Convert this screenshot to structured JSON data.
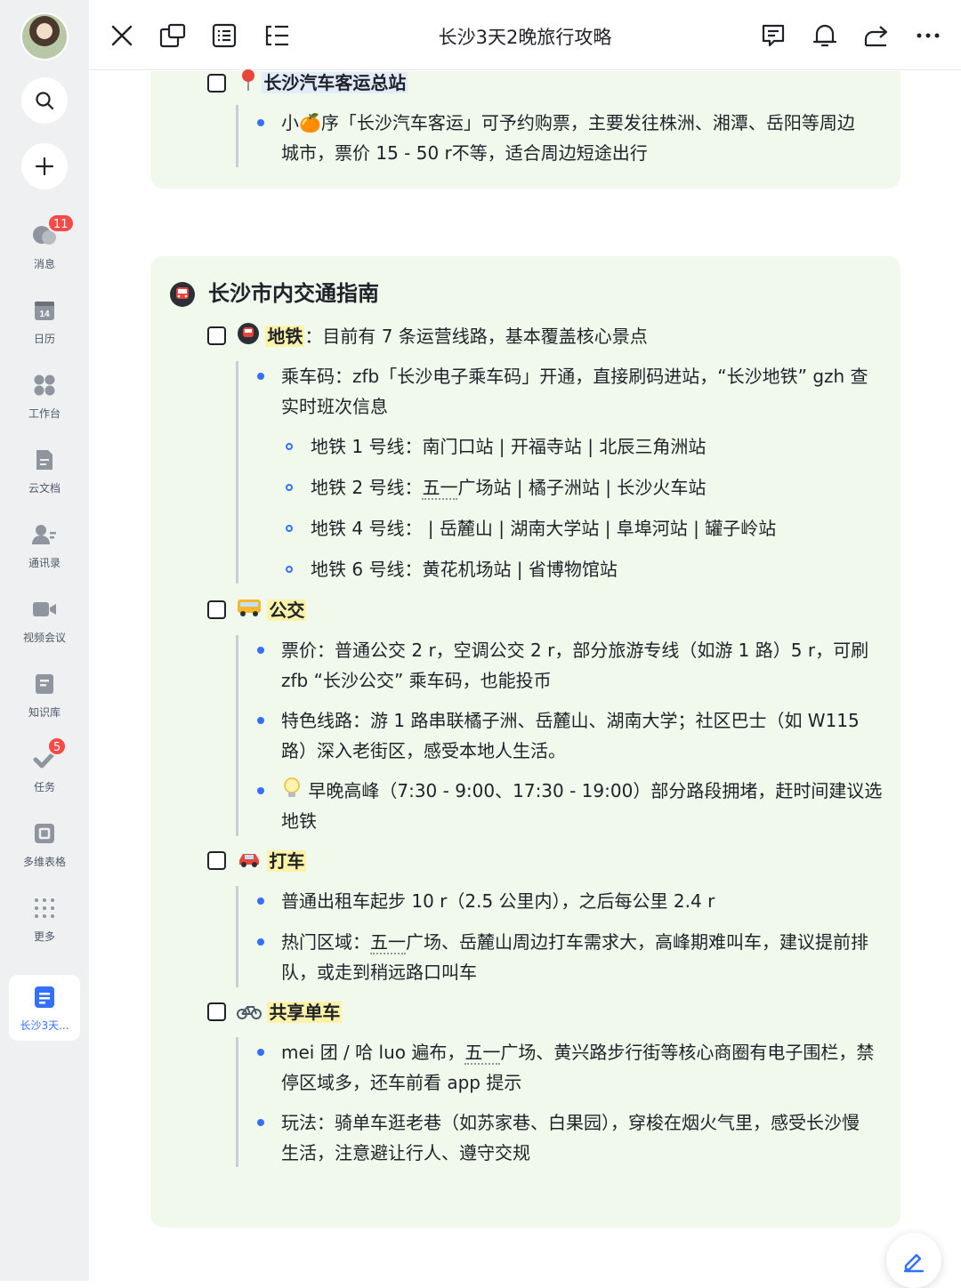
{
  "window": {
    "title": "长沙3天2晚旅行攻略"
  },
  "sidebar": {
    "items": [
      {
        "label": "消息",
        "badge": "11"
      },
      {
        "label": "日历",
        "day": "14"
      },
      {
        "label": "工作台"
      },
      {
        "label": "云文档"
      },
      {
        "label": "通讯录"
      },
      {
        "label": "视频会议"
      },
      {
        "label": "知识库"
      },
      {
        "label": "任务",
        "badge": "5"
      },
      {
        "label": "多维表格"
      },
      {
        "label": "更多"
      },
      {
        "label": "长沙3天..."
      }
    ]
  },
  "doc": {
    "bus_station": {
      "title": "长沙汽车客运总站",
      "line1": "小🍊序「长沙汽车客运」可予约购票，主要发往株洲、湘潭、岳阳等周边",
      "line2": "城市，票价 15 - 50 r不等，适合周边短途出行"
    },
    "transport": {
      "heading": "长沙市内交通指南",
      "metro": {
        "title": "地铁",
        "desc": "：目前有 7 条运营线路，基本覆盖核心景点",
        "code_line1": "乘车码：zfb「长沙电子乘车码」开通，直接刷码进站，“长沙地铁” gzh 查",
        "code_line2": "实时班次信息",
        "line1": "地铁 1 号线：南门口站 | 开福寺站 | 北辰三角洲站",
        "line2_prefix": "地铁 2 号线：",
        "line2_dotted": "五一",
        "line2_rest": "广场站 | 橘子洲站 | 长沙火车站",
        "line4": "地铁 4 号线：  | 岳麓山 | 湖南大学站 | 阜埠河站 | 罐子岭站",
        "line6": "地铁 6 号线：黄花机场站 | 省博物馆站"
      },
      "bus": {
        "title": "公交",
        "p1_line1": "票价：普通公交 2 r，空调公交 2 r，部分旅游专线（如游 1 路）5 r，可刷",
        "p1_line2": "zfb “长沙公交” 乘车码，也能投币",
        "p2_line1": "特色线路：游 1 路串联橘子洲、岳麓山、湖南大学；社区巴士（如 W115",
        "p2_line2": "路）深入老街区，感受本地人生活。",
        "p3_line1": "早晚高峰（7:30 - 9:00、17:30 - 19:00）部分路段拥堵，赶时间建议选",
        "p3_line2": "地铁"
      },
      "taxi": {
        "title": "打车",
        "p1": "普通出租车起步 10 r（2.5 公里内），之后每公里 2.4 r",
        "p2_prefix": "热门区域：",
        "p2_dotted": "五一",
        "p2_rest": "广场、岳麓山周边打车需求大，高峰期难叫车，建议提前排",
        "p2_line2": "队，或走到稍远路口叫车"
      },
      "bike": {
        "title": "共享单车",
        "p1_prefix": "mei 团 / 哈 luo 遍布，",
        "p1_dotted": "五一",
        "p1_rest": "广场、黄兴路步行街等核心商圈有电子围栏，禁",
        "p1_line2": "停区域多，还车前看 app 提示",
        "p2_line1": "玩法：骑单车逛老巷（如苏家巷、白果园），穿梭在烟火气里，感受长沙慢",
        "p2_line2": "生活，注意避让行人、遵守交规"
      }
    }
  },
  "colors": {
    "accent": "#3370ff",
    "card_bg": "#f0f9ec",
    "highlight": "#fdf3a8",
    "badge": "#f54a45"
  }
}
